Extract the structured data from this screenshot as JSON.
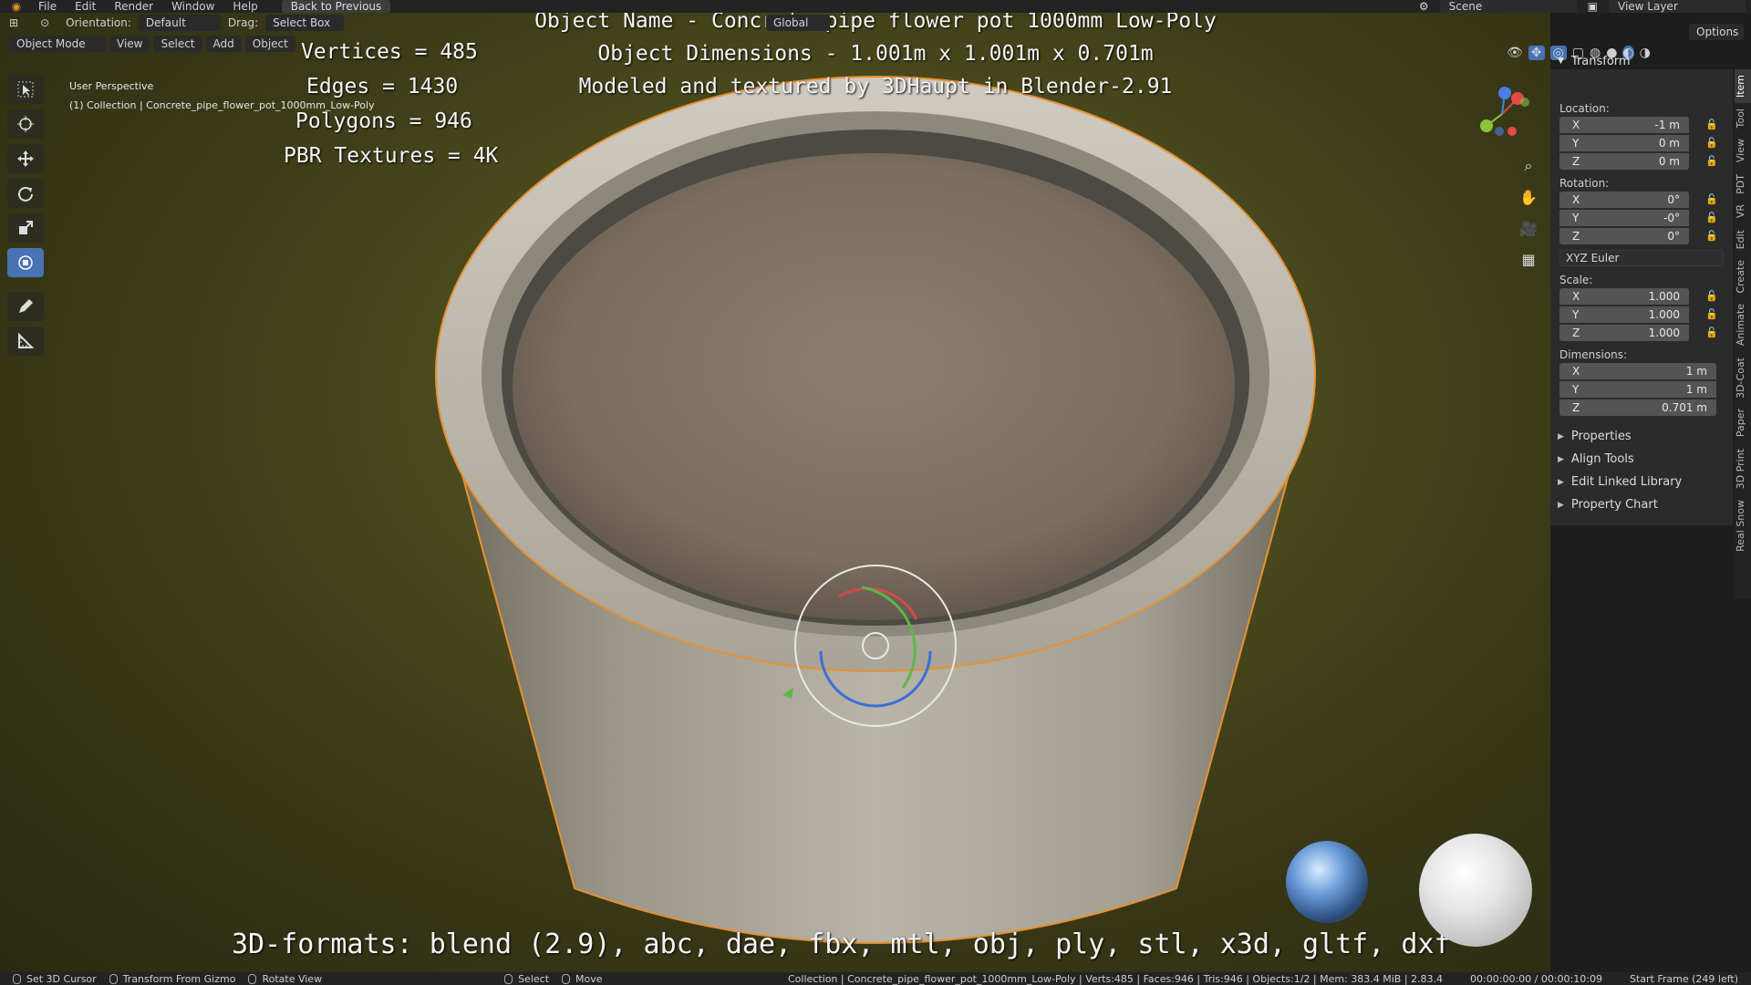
{
  "topbar": {
    "menus": [
      "File",
      "Edit",
      "Render",
      "Window",
      "Help"
    ],
    "back_button": "Back to Previous",
    "scene_label": "Scene",
    "view_layer_label": "View Layer"
  },
  "tool_header": {
    "orientation_label": "Orientation:",
    "orientation_value": "Default",
    "drag_label": "Drag:",
    "drag_value": "Select Box",
    "transform_orientation": "Global",
    "options_label": "Options"
  },
  "mode_header": {
    "mode": "Object Mode",
    "view": "View",
    "select": "Select",
    "add": "Add",
    "object": "Object"
  },
  "viewport_info": {
    "perspective": "User Perspective",
    "collection": "(1) Collection | Concrete_pipe_flower_pot_1000mm_Low-Poly"
  },
  "overlay": {
    "object_name": "Object Name - Concrete pipe flower pot 1000mm Low-Poly",
    "object_dimensions": "Object Dimensions -  1.001m x 1.001m x 0.701m",
    "credits": "Modeled and textured by 3DHaupt in Blender-2.91",
    "vertices": "Vertices = 485",
    "edges": "Edges = 1430",
    "polygons": "Polygons = 946",
    "pbr": "PBR Textures = 4K",
    "formats": "3D-formats: blend (2.9), abc, dae, fbx, mtl, obj, ply, stl, x3d, gltf, dxf"
  },
  "sidebar": {
    "transform_title": "Transform",
    "location_label": "Location:",
    "location": [
      {
        "axis": "X",
        "value": "-1 m"
      },
      {
        "axis": "Y",
        "value": "0 m"
      },
      {
        "axis": "Z",
        "value": "0 m"
      }
    ],
    "rotation_label": "Rotation:",
    "rotation": [
      {
        "axis": "X",
        "value": "0°"
      },
      {
        "axis": "Y",
        "value": "-0°"
      },
      {
        "axis": "Z",
        "value": "0°"
      }
    ],
    "rotation_mode": "XYZ Euler",
    "scale_label": "Scale:",
    "scale": [
      {
        "axis": "X",
        "value": "1.000"
      },
      {
        "axis": "Y",
        "value": "1.000"
      },
      {
        "axis": "Z",
        "value": "1.000"
      }
    ],
    "dimensions_label": "Dimensions:",
    "dimensions": [
      {
        "axis": "X",
        "value": "1 m"
      },
      {
        "axis": "Y",
        "value": "1 m"
      },
      {
        "axis": "Z",
        "value": "0.701 m"
      }
    ],
    "panels": [
      "Properties",
      "Align Tools",
      "Edit Linked Library",
      "Property Chart"
    ],
    "tabs": [
      "Item",
      "Tool",
      "View",
      "PDT",
      "VR",
      "Edit",
      "Create",
      "Animate",
      "3D-Coat",
      "Paper",
      "3D Print",
      "Real Snow"
    ]
  },
  "statusbar": {
    "set_cursor": "Set 3D Cursor",
    "transform_gizmo": "Transform From Gizmo",
    "rotate_view": "Rotate View",
    "select": "Select",
    "move": "Move",
    "stats": "Collection | Concrete_pipe_flower_pot_1000mm_Low-Poly | Verts:485 | Faces:946 | Tris:946 | Objects:1/2 | Mem: 383.4 MiB | 2.83.4",
    "time": "00:00:00:00 / 00:00:10:09",
    "frame": "Start Frame (249 left)"
  },
  "colors": {
    "accent": "#4772b3",
    "selection_outline": "#e8902f",
    "background_olive": "#4b4a1e"
  }
}
